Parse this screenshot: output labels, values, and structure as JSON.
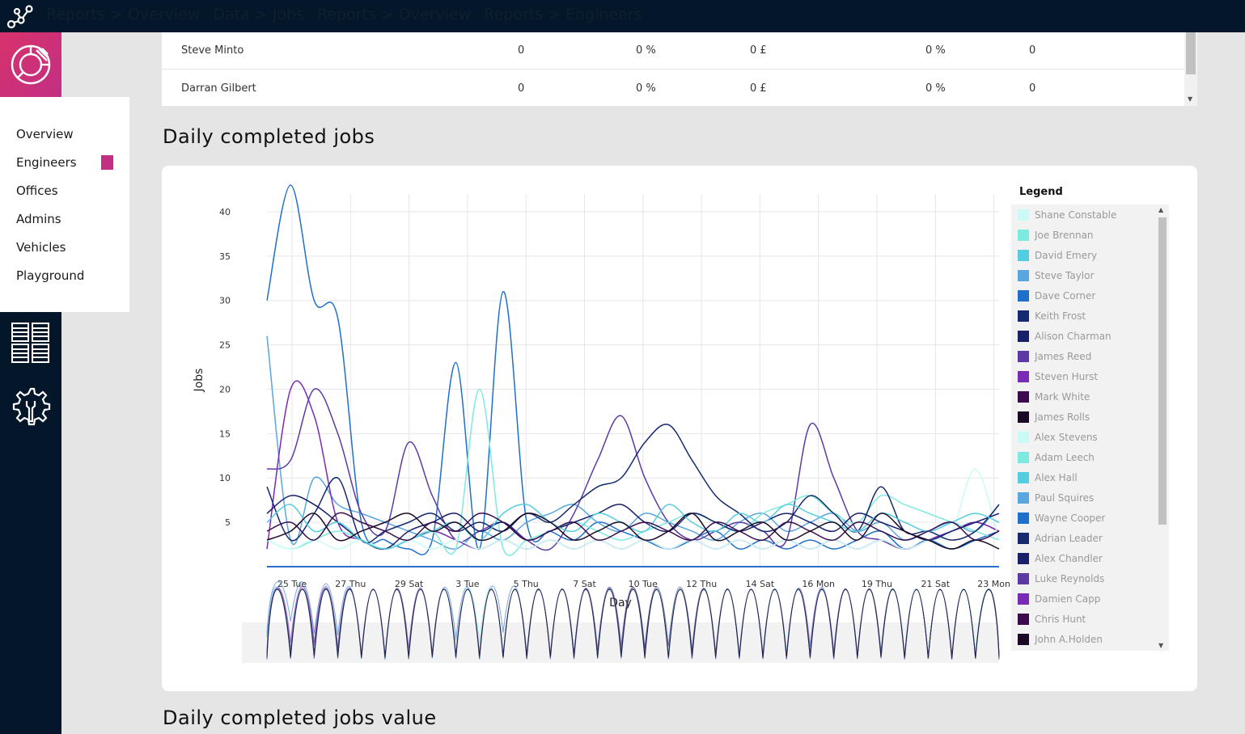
{
  "breadcrumbs": [
    "Reports > Overview",
    "Data > Jobs",
    "Reports > Overview",
    "Reports > Engineers"
  ],
  "submenu": [
    {
      "label": "Overview",
      "active": false
    },
    {
      "label": "Engineers",
      "active": true
    },
    {
      "label": "Offices",
      "active": false
    },
    {
      "label": "Admins",
      "active": false
    },
    {
      "label": "Vehicles",
      "active": false
    },
    {
      "label": "Playground",
      "active": false
    }
  ],
  "table": {
    "rows": [
      {
        "name": "Steve Minto",
        "jobs": "0",
        "pct1": "0 %",
        "value": "0 £",
        "pct2": "0 %",
        "count": "0"
      },
      {
        "name": "Darran Gilbert",
        "jobs": "0",
        "pct1": "0 %",
        "value": "0 £",
        "pct2": "0 %",
        "count": "0"
      }
    ]
  },
  "sections": {
    "daily_jobs": "Daily completed jobs",
    "daily_jobs_value": "Daily completed jobs value"
  },
  "legend": {
    "title": "Legend",
    "items": [
      {
        "name": "Shane Constable",
        "color": "#c9fbf6"
      },
      {
        "name": "Joe Brennan",
        "color": "#7eeadf"
      },
      {
        "name": "David Emery",
        "color": "#55cde0"
      },
      {
        "name": "Steve Taylor",
        "color": "#5aa6de"
      },
      {
        "name": "Dave Corner",
        "color": "#1f6fcb"
      },
      {
        "name": "Keith Frost",
        "color": "#152a6f"
      },
      {
        "name": "Alison Charman",
        "color": "#18206a"
      },
      {
        "name": "James Reed",
        "color": "#5d3aa3"
      },
      {
        "name": "Steven Hurst",
        "color": "#7a2bb5"
      },
      {
        "name": "Mark White",
        "color": "#3b0b4d"
      },
      {
        "name": "James Rolls",
        "color": "#1b0a26"
      },
      {
        "name": "Alex Stevens",
        "color": "#c9fbf6"
      },
      {
        "name": "Adam Leech",
        "color": "#7eeadf"
      },
      {
        "name": "Alex Hall",
        "color": "#55cde0"
      },
      {
        "name": "Paul Squires",
        "color": "#5aa6de"
      },
      {
        "name": "Wayne Cooper",
        "color": "#1f6fcb"
      },
      {
        "name": "Adrian Leader",
        "color": "#152a6f"
      },
      {
        "name": "Alex Chandler",
        "color": "#18206a"
      },
      {
        "name": "Luke Reynolds",
        "color": "#5d3aa3"
      },
      {
        "name": "Damien Capp",
        "color": "#7a2bb5"
      },
      {
        "name": "Chris Hunt",
        "color": "#3b0b4d"
      },
      {
        "name": "John A.Holden",
        "color": "#1b0a26"
      }
    ]
  },
  "chart_data": {
    "type": "line",
    "xlabel": "Day",
    "ylabel": "Jobs",
    "ylim": [
      0,
      42
    ],
    "y_ticks": [
      5,
      10,
      15,
      20,
      25,
      30,
      35,
      40
    ],
    "x_ticks": [
      "25 Tue",
      "27 Thu",
      "29 Sat",
      "3 Tue",
      "5 Thu",
      "7 Sat",
      "10 Tue",
      "12 Thu",
      "14 Sat",
      "16 Mon",
      "19 Thu",
      "21 Sat",
      "23 Mon"
    ],
    "grid": true,
    "legend_position": "right",
    "series": [
      {
        "name": "Dave Corner",
        "color": "#1f6fcb",
        "values": [
          30,
          43,
          30,
          28,
          5,
          3,
          2,
          3,
          23,
          2,
          31,
          5,
          4,
          3,
          5,
          4,
          3,
          2,
          3,
          4,
          2,
          3,
          2,
          3,
          2,
          3,
          4,
          2,
          3,
          2,
          3,
          4
        ]
      },
      {
        "name": "Steve Taylor",
        "color": "#5aa6de",
        "values": [
          26,
          3,
          10,
          7,
          6,
          5,
          4,
          3,
          2,
          4,
          3,
          5,
          6,
          7,
          5,
          4,
          6,
          5,
          4,
          3,
          5,
          6,
          4,
          5,
          6,
          4,
          5,
          3,
          4,
          5,
          4,
          7
        ]
      },
      {
        "name": "James Reed",
        "color": "#5d3aa3",
        "values": [
          11,
          12,
          20,
          15,
          6,
          4,
          14,
          8,
          3,
          4,
          5,
          3,
          2,
          6,
          12,
          17,
          10,
          5,
          3,
          4,
          5,
          4,
          3,
          16,
          10,
          4,
          3,
          2,
          3,
          4,
          5,
          4
        ]
      },
      {
        "name": "Steven Hurst",
        "color": "#7a2bb5",
        "values": [
          2,
          20,
          17,
          5,
          3,
          2,
          3,
          4,
          3,
          2,
          3,
          2,
          3,
          2,
          3,
          2,
          3,
          2,
          3,
          2,
          3,
          2,
          3,
          2,
          3,
          2,
          3,
          2,
          3,
          4,
          5,
          4
        ]
      },
      {
        "name": "Joe Brennan",
        "color": "#7eeadf",
        "values": [
          3,
          2,
          3,
          4,
          3,
          2,
          3,
          4,
          2,
          20,
          2,
          3,
          4,
          5,
          4,
          3,
          4,
          5,
          6,
          5,
          4,
          6,
          7,
          8,
          6,
          5,
          8,
          7,
          6,
          5,
          4,
          3
        ]
      },
      {
        "name": "Shane Constable",
        "color": "#c9fbf6",
        "values": [
          3,
          2,
          3,
          2,
          3,
          2,
          3,
          2,
          3,
          2,
          3,
          2,
          3,
          2,
          3,
          2,
          3,
          2,
          3,
          2,
          3,
          2,
          3,
          2,
          3,
          2,
          3,
          2,
          3,
          4,
          11,
          3
        ]
      },
      {
        "name": "Keith Frost",
        "color": "#152a6f",
        "values": [
          9,
          3,
          6,
          10,
          3,
          4,
          5,
          6,
          4,
          5,
          4,
          6,
          5,
          7,
          9,
          10,
          14,
          16,
          12,
          8,
          6,
          4,
          5,
          8,
          6,
          4,
          9,
          4,
          4,
          3,
          4,
          7
        ]
      },
      {
        "name": "Alison Charman",
        "color": "#18206a",
        "values": [
          6,
          8,
          7,
          5,
          3,
          2,
          4,
          5,
          6,
          4,
          5,
          3,
          4,
          5,
          6,
          7,
          5,
          4,
          6,
          5,
          4,
          5,
          6,
          5,
          4,
          6,
          5,
          4,
          3,
          4,
          5,
          6
        ]
      },
      {
        "name": "David Emery",
        "color": "#55cde0",
        "values": [
          5,
          7,
          4,
          5,
          3,
          2,
          3,
          4,
          5,
          3,
          6,
          7,
          5,
          4,
          6,
          5,
          4,
          7,
          5,
          4,
          6,
          5,
          7,
          6,
          5,
          4,
          6,
          5,
          4,
          5,
          6,
          5
        ]
      },
      {
        "name": "Mark White",
        "color": "#3b0b4d",
        "values": [
          4,
          5,
          3,
          6,
          5,
          4,
          3,
          5,
          4,
          6,
          5,
          3,
          4,
          5,
          3,
          4,
          5,
          4,
          3,
          5,
          4,
          3,
          5,
          4,
          3,
          5,
          4,
          3,
          4,
          5,
          3,
          4
        ]
      },
      {
        "name": "James Rolls",
        "color": "#1b0a26",
        "values": [
          3,
          4,
          6,
          3,
          4,
          5,
          6,
          4,
          5,
          3,
          4,
          6,
          5,
          3,
          4,
          5,
          3,
          4,
          6,
          3,
          4,
          5,
          3,
          4,
          5,
          3,
          6,
          4,
          3,
          2,
          3,
          2
        ]
      }
    ]
  }
}
